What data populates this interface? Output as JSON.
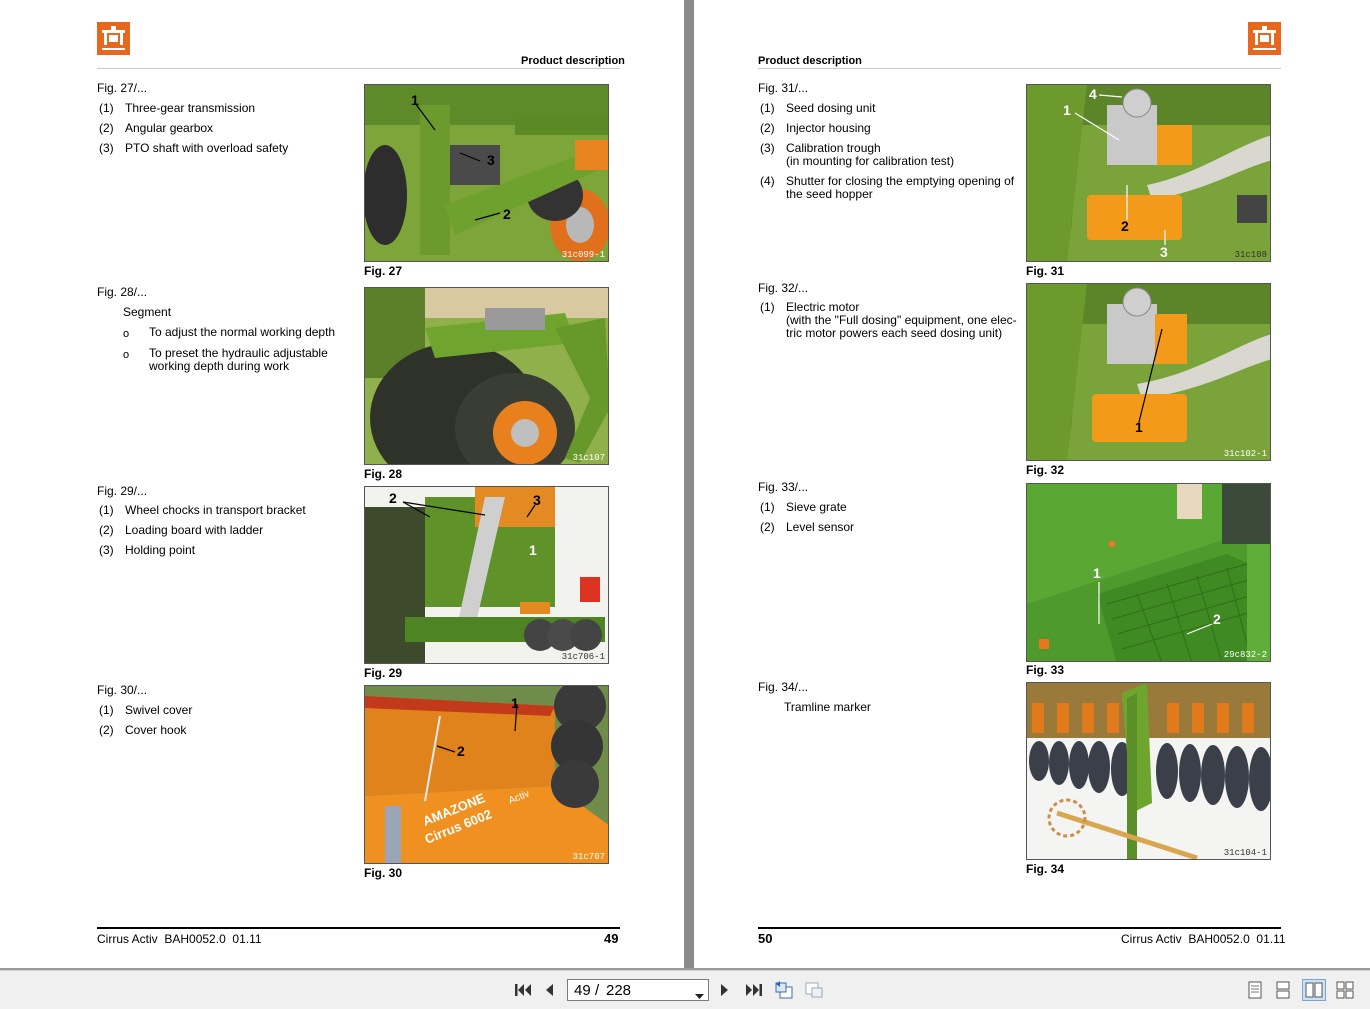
{
  "header_label": "Product description",
  "left_page": {
    "footer_product": "Cirrus Activ",
    "footer_doc": "BAH0052.0",
    "footer_date": "01.11",
    "page_number": "49",
    "sections": [
      {
        "title": "Fig. 27/...",
        "items": [
          {
            "num": "(1)",
            "text": "Three-gear transmission"
          },
          {
            "num": "(2)",
            "text": "Angular gearbox"
          },
          {
            "num": "(3)",
            "text": "PTO shaft with overload safety"
          }
        ],
        "caption": "Fig. 27",
        "code": "31c099-1"
      },
      {
        "title": "Fig. 28/...",
        "heading": "Segment",
        "bullets": [
          {
            "marker": "o",
            "line1": "To adjust the normal working depth",
            "line2": ""
          },
          {
            "marker": "o",
            "line1": "To preset the hydraulic adjustable",
            "line2": "working depth during work"
          }
        ],
        "caption": "Fig. 28",
        "code": "31c107"
      },
      {
        "title": "Fig. 29/...",
        "items": [
          {
            "num": "(1)",
            "text": "Wheel chocks in transport bracket"
          },
          {
            "num": "(2)",
            "text": "Loading board with ladder"
          },
          {
            "num": "(3)",
            "text": "Holding point"
          }
        ],
        "caption": "Fig. 29",
        "code": "31c706-1"
      },
      {
        "title": "Fig. 30/...",
        "items": [
          {
            "num": "(1)",
            "text": "Swivel cover"
          },
          {
            "num": "(2)",
            "text": "Cover hook"
          }
        ],
        "caption": "Fig. 30",
        "code": "31c707",
        "machine_text": "Cirrus 6002",
        "brand_text": "AMAZONE",
        "activ_text": "Activ"
      }
    ]
  },
  "right_page": {
    "footer_product": "Cirrus Activ",
    "footer_doc": "BAH0052.0",
    "footer_date": "01.11",
    "page_number": "50",
    "sections": [
      {
        "title": "Fig. 31/...",
        "items": [
          {
            "num": "(1)",
            "line1": "Seed dosing unit",
            "line2": ""
          },
          {
            "num": "(2)",
            "line1": "Injector housing",
            "line2": ""
          },
          {
            "num": "(3)",
            "line1": "Calibration trough",
            "line2": "(in mounting for calibration test)"
          },
          {
            "num": "(4)",
            "line1": "Shutter for closing the emptying opening of",
            "line2": "the seed hopper"
          }
        ],
        "caption": "Fig. 31",
        "code": "31c108"
      },
      {
        "title": "Fig. 32/...",
        "items": [
          {
            "num": "(1)",
            "line1": "Electric motor",
            "line2": "(with the \"Full dosing\" equipment, one elec-",
            "line3": "tric motor powers each seed dosing unit)"
          }
        ],
        "caption": "Fig. 32",
        "code": "31c102-1"
      },
      {
        "title": "Fig. 33/...",
        "items": [
          {
            "num": "(1)",
            "text": "Sieve grate"
          },
          {
            "num": "(2)",
            "text": "Level sensor"
          }
        ],
        "caption": "Fig. 33",
        "code": "29c832-2"
      },
      {
        "title": "Fig. 34/...",
        "heading": "Tramline marker",
        "caption": "Fig. 34",
        "code": "31c104-1"
      }
    ]
  },
  "figure_labels": {
    "one": "1",
    "two": "2",
    "three": "3",
    "four": "4"
  },
  "toolbar": {
    "current_page": "49",
    "separator": "/",
    "total_pages": "228"
  },
  "colors": {
    "brand_orange": "#e8671f",
    "machine_green": "#6e9a2e",
    "machine_orange": "#f08a1a"
  }
}
